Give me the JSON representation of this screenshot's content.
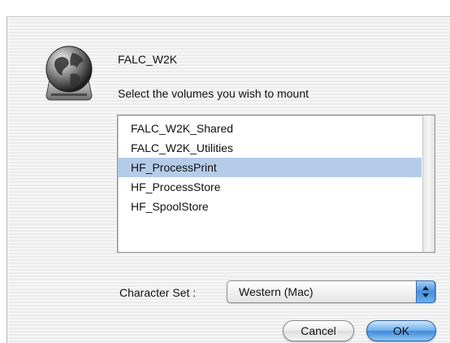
{
  "dialog": {
    "server_name": "FALC_W2K",
    "prompt": "Select the volumes you wish to mount",
    "icon": "globe-server-icon"
  },
  "volumes": [
    {
      "label": "FALC_W2K_Shared",
      "selected": false
    },
    {
      "label": "FALC_W2K_Utilities",
      "selected": false
    },
    {
      "label": "HF_ProcessPrint",
      "selected": true
    },
    {
      "label": "HF_ProcessStore",
      "selected": false
    },
    {
      "label": "HF_SpoolStore",
      "selected": false
    }
  ],
  "charset": {
    "label": "Character Set :",
    "value": "Western (Mac)"
  },
  "buttons": {
    "cancel": "Cancel",
    "ok": "OK"
  },
  "colors": {
    "selection": "#b5cce9",
    "default_button": "#4a90dc"
  }
}
